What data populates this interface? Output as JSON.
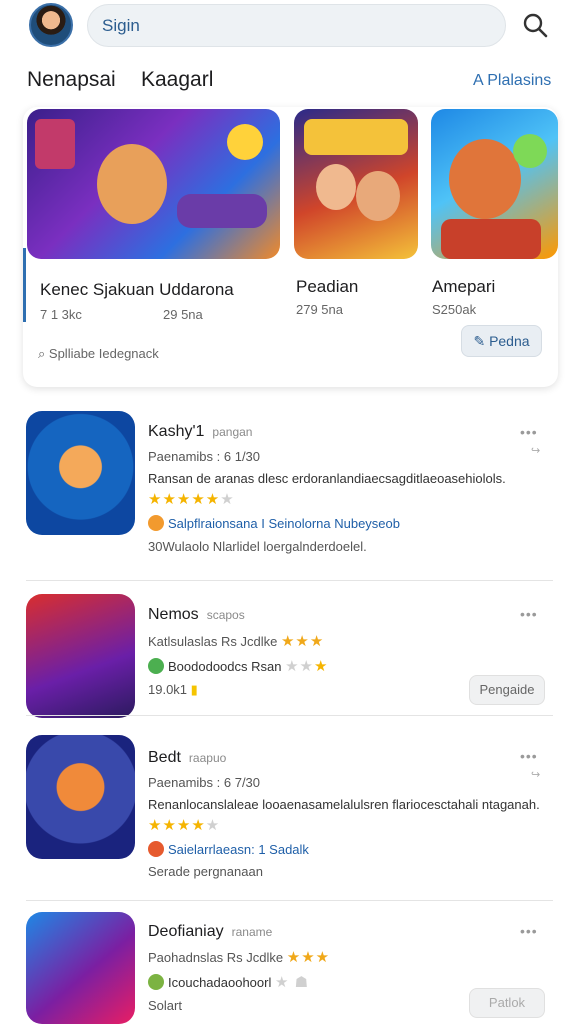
{
  "header": {
    "search_value": "Sigin"
  },
  "section": {
    "title_a": "Nenapsai",
    "title_b": "Kaagarl",
    "link": "A Plalasins"
  },
  "featured": {
    "cards": [
      {
        "name": "Kenec Sjakuan Uddarona",
        "stat": "7 1 3kc",
        "stat2": "29 5na"
      },
      {
        "name": "Peadian",
        "stat": "279 5na"
      },
      {
        "name": "Amepari",
        "stat": "S250ak"
      }
    ],
    "footer": "Splliabe Iedegnack",
    "button": "Pedna"
  },
  "apps": [
    {
      "name": "Kashy'1",
      "tag": "pangan",
      "line1": "Paenamibs :  6 1/30",
      "line2": "Ransan de aranas dlesc erdoranlandiaecsagditlaeoasehiolols.",
      "rating_stars": 5,
      "line3": "Salpflraionsana  I Seinolorna  Nubeyseob",
      "line4": "30Wulaolo Nlarlidel loergalnderdoelel."
    },
    {
      "name": "Nemos",
      "tag": "scapos",
      "line1": "Katlsulaslas Rs  Jcdlke",
      "line2": "Boododoodcs Rsan",
      "line3": "19.0k1",
      "action": "Pengaide"
    },
    {
      "name": "Bedt",
      "tag": "raapuo",
      "line1": "Paenamibs :  6 7/30",
      "line2": "Renanlocanslaleae looaenasamelalulsren flariocesctahali ntaganah.",
      "rating_stars": 4,
      "line3": "Saielarrlaeasn:  1 Sadalk",
      "line4": "Serade pergnanaan"
    },
    {
      "name": "Deofianiay",
      "tag": "raname",
      "line1": "Paohadnslas Rs  Jcdlke",
      "line2": "Icouchadaoohoorl",
      "line3": "Solart",
      "action": "Patlok"
    }
  ],
  "colors": {
    "accent": "#2e6fb1",
    "star": "#f5b400"
  }
}
